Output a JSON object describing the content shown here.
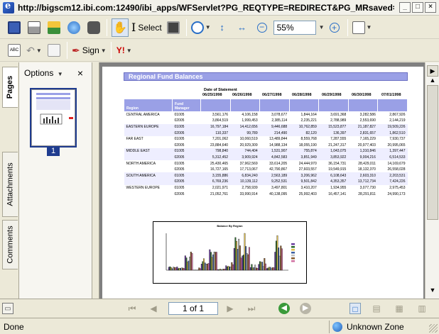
{
  "window": {
    "title": "http://bigscm12.ibi.com:12490/ibi_apps/WFServlet?PG_REQTYPE=REDIRECT&PG_MRsaved=..."
  },
  "toolbar": {
    "select_label": "Select",
    "zoom_value": "55%",
    "sign_label": "Sign"
  },
  "nav_tabs": {
    "pages": "Pages",
    "attachments": "Attachments",
    "comments": "Comments"
  },
  "pages_panel": {
    "options_label": "Options",
    "thumb_page_number": "1"
  },
  "report": {
    "title": "Regional Fund Balances",
    "date_label": "Date of  Statement",
    "region_header": "Region",
    "manager_header": "Fund Manager",
    "dates": [
      "06/25/1998",
      "06/26/1998",
      "06/27/1998",
      "06/28/1998",
      "06/29/1998",
      "06/30/1998",
      "07/01/1998"
    ],
    "rows": [
      {
        "region": "CENTRAL AMERICA",
        "manager": "01005",
        "values": [
          "3,561,176",
          "4,106,158",
          "3,078,677",
          "1,844,164",
          "3,691,368",
          "3,282,586",
          "2,867,926"
        ]
      },
      {
        "region": "",
        "manager": "02005",
        "values": [
          "3,864,519",
          "1,999,453",
          "2,385,114",
          "2,235,221",
          "2,788,989",
          "2,553,690",
          "2,144,219"
        ]
      },
      {
        "region": "EASTERN EUROPE",
        "manager": "01005",
        "values": [
          "16,797,184",
          "14,412,656",
          "9,446,688",
          "10,762,859",
          "15,523,877",
          "21,187,827",
          "19,509,226"
        ]
      },
      {
        "region": "",
        "manager": "02005",
        "values": [
          "110,337",
          "99,789",
          "214,490",
          "82,120",
          "136,397",
          "2,831,657",
          "1,862,510"
        ]
      },
      {
        "region": "FAR EAST",
        "manager": "01005",
        "values": [
          "7,201,062",
          "10,060,519",
          "13,489,844",
          "8,559,768",
          "7,287,555",
          "7,165,229",
          "7,930,737"
        ]
      },
      {
        "region": "",
        "manager": "02005",
        "values": [
          "23,884,640",
          "20,929,309",
          "14,988,134",
          "18,055,190",
          "21,247,317",
          "20,977,403",
          "20,995,065"
        ]
      },
      {
        "region": "MIDDLE EAST",
        "manager": "01005",
        "values": [
          "798,840",
          "744,404",
          "1,531,907",
          "755,874",
          "1,043,075",
          "1,310,846",
          "1,397,447"
        ]
      },
      {
        "region": "",
        "manager": "02005",
        "values": [
          "5,312,452",
          "3,909,924",
          "4,842,583",
          "3,851,949",
          "3,853,922",
          "9,004,216",
          "6,514,533"
        ]
      },
      {
        "region": "NORTH AMERICA",
        "manager": "01005",
        "values": [
          "25,430,465",
          "37,962,569",
          "33,614,205",
          "24,444,970",
          "36,154,731",
          "28,429,011",
          "14,169,679"
        ]
      },
      {
        "region": "",
        "manager": "02005",
        "values": [
          "16,727,165",
          "17,713,067",
          "42,790,867",
          "27,603,557",
          "19,549,915",
          "18,132,370",
          "26,558,028"
        ]
      },
      {
        "region": "SOUTH AMERICA",
        "manager": "01005",
        "values": [
          "3,155,886",
          "6,834,240",
          "2,563,189",
          "3,206,962",
          "6,108,643",
          "2,603,310",
          "2,203,531"
        ]
      },
      {
        "region": "",
        "manager": "02005",
        "values": [
          "6,769,236",
          "10,139,112",
          "9,252,531",
          "9,501,842",
          "4,353,357",
          "13,712,734",
          "7,424,226"
        ]
      },
      {
        "region": "WESTERN EUROPE",
        "manager": "01005",
        "values": [
          "2,021,971",
          "2,758,939",
          "3,497,801",
          "3,410,207",
          "1,934,955",
          "3,077,730",
          "2,975,453"
        ]
      },
      {
        "region": "",
        "manager": "02005",
        "values": [
          "21,052,761",
          "33,990,914",
          "40,138,095",
          "25,992,403",
          "16,457,141",
          "28,291,811",
          "24,990,173"
        ]
      }
    ],
    "chart_title": "Balance By Region"
  },
  "bottom_nav": {
    "page_indicator": "1 of 1"
  },
  "status": {
    "text": "Done",
    "zone": "Unknown Zone"
  },
  "colors": {
    "header_fill": "#9aa0e6",
    "band_fill": "#eeeeff",
    "page_selected": "#1f3c8f"
  }
}
